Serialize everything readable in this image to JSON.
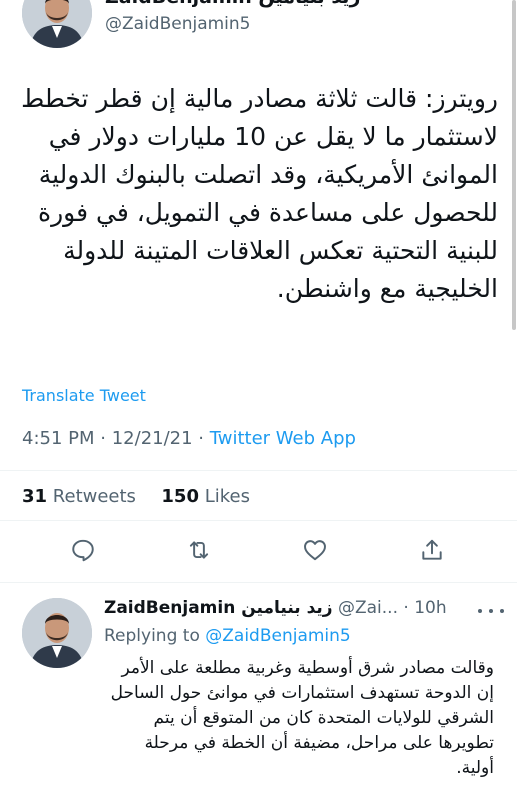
{
  "tweet": {
    "author_name": "ZaidBenjamin زيد بنيامين",
    "author_handle": "@ZaidBenjamin5",
    "text": "رويترز: قالت ثلاثة مصادر مالية إن قطر تخطط لاستثمار ما لا يقل عن 10 مليارات دولار في الموانئ الأمريكية، وقد اتصلت بالبنوك الدولية للحصول على مساعدة في التمويل، في فورة للبنية التحتية تعكس العلاقات المتينة للدولة الخليجية مع واشنطن.",
    "translate_label": "Translate Tweet",
    "time": "4:51 PM",
    "date": "12/21/21",
    "source": "Twitter Web App",
    "retweets_count": "31",
    "retweets_label": "Retweets",
    "likes_count": "150",
    "likes_label": "Likes"
  },
  "actions": {
    "icons": [
      "reply-icon",
      "retweet-icon",
      "like-icon",
      "share-icon"
    ]
  },
  "reply": {
    "author_name": "ZaidBenjamin زيد بنيامين",
    "author_handle": "@Zai...",
    "time": "10h",
    "replying_prefix": "Replying to",
    "replying_to": "@ZaidBenjamin5",
    "text": "وقالت مصادر شرق أوسطية وغربية مطلعة على الأمر إن الدوحة تستهدف استثمارات في موانئ حول الساحل الشرقي للولايات المتحدة كان من المتوقع أن يتم تطويرها على مراحل، مضيفة أن الخطة في مرحلة أولية."
  },
  "colors": {
    "accent": "#1d9bf0",
    "secondary_text": "#536471",
    "primary_text": "#0f1419",
    "divider": "#eff3f4"
  }
}
